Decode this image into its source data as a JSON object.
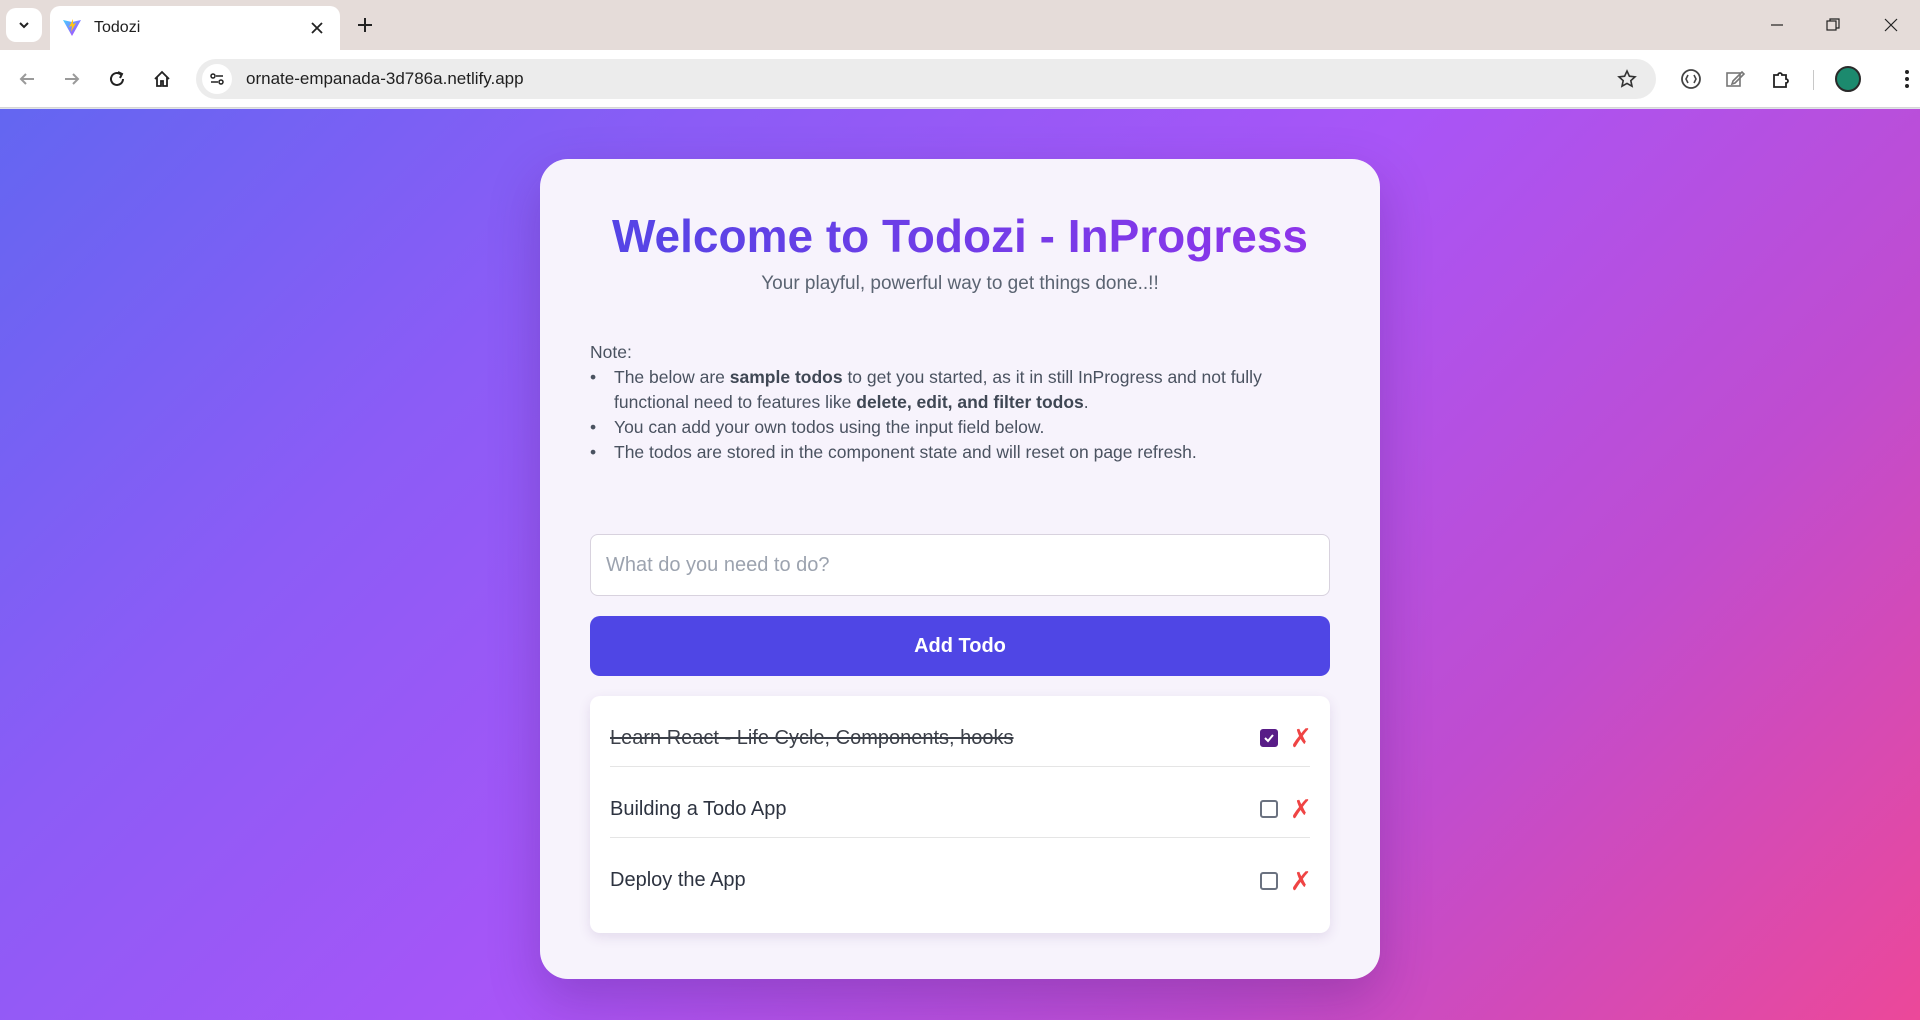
{
  "browser": {
    "tab_title": "Todozi",
    "url": "ornate-empanada-3d786a.netlify.app"
  },
  "app": {
    "title": "Welcome to Todozi - InProgress",
    "subtitle": "Your playful, powerful way to get things done..!!",
    "note": {
      "heading": "Note:",
      "item1_a": "The below are ",
      "item1_b": "sample todos",
      "item1_c": " to get you started, as it in still InProgress and not fully functional need to features like ",
      "item1_d": "delete, edit, and filter todos",
      "item1_e": ".",
      "item2": "You can add your own todos using the input field below.",
      "item3": "The todos are stored in the component state and will reset on page refresh."
    },
    "input": {
      "placeholder": "What do you need to do?",
      "value": ""
    },
    "add_button": "Add Todo",
    "todos": [
      {
        "text": "Learn React - Life Cycle, Components, hooks",
        "completed": true
      },
      {
        "text": "Building a Todo App",
        "completed": false
      },
      {
        "text": "Deploy the App",
        "completed": false
      }
    ],
    "delete_glyph": "✗"
  },
  "colors": {
    "accent": "#4f46e5",
    "delete": "#ef4444",
    "checked": "#581c87"
  }
}
